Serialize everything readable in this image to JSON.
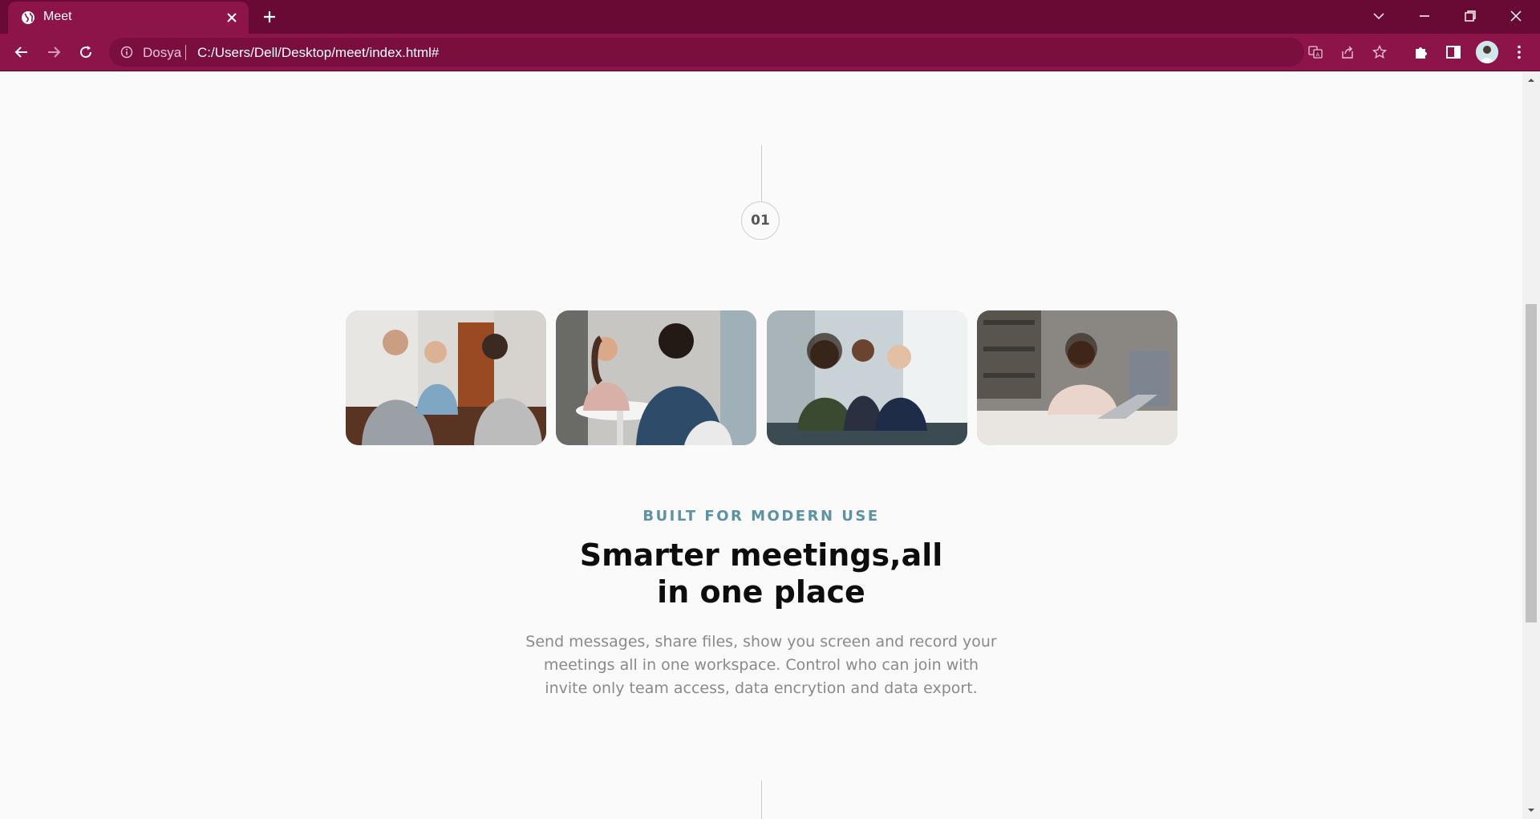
{
  "browser": {
    "tab_title": "Meet",
    "site_name": "Dosya",
    "url": "C:/Users/Dell/Desktop/meet/index.html#",
    "theme_color": "#8d1448",
    "frame_color": "#680a34"
  },
  "section": {
    "step_number": "01",
    "eyebrow": "BUILT FOR MODERN USE",
    "headline_line1": "Smarter meetings,all",
    "headline_line2": "in one place",
    "description": "Send messages, share files, show you screen and record your meetings all in one workspace. Control who can join with invite only team access, data encrytion and data export.",
    "eyebrow_color": "#5c92a3"
  },
  "icons": {
    "tab_favicon": "globe-icon",
    "tab_close": "close-icon",
    "new_tab": "plus-icon",
    "back": "arrow-left-icon",
    "forward": "arrow-right-icon",
    "reload": "reload-icon",
    "site_info": "info-icon",
    "translate": "translate-icon",
    "share": "share-icon",
    "bookmark": "star-icon",
    "extensions": "puzzle-icon",
    "side_panel": "side-panel-icon",
    "menu": "kebab-menu-icon"
  }
}
